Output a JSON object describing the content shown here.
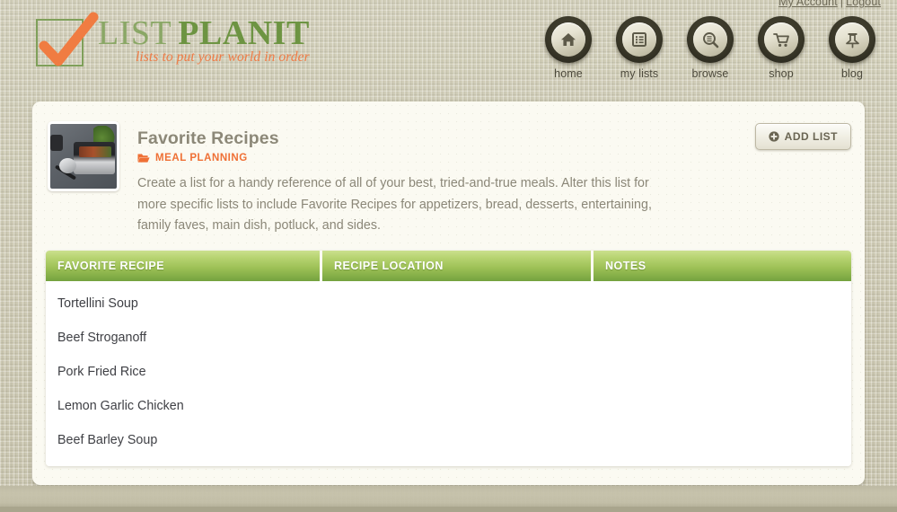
{
  "account": {
    "my_account": "My Account",
    "separator": "|",
    "logout": "Logout"
  },
  "logo": {
    "word1": "LIST",
    "word2": "PLANIT",
    "tagline": "lists to put your world in order",
    "check_icon": "orange-checkmark-icon",
    "colors": {
      "word1": "#8aa766",
      "word2": "#6d9442",
      "tagline": "#ef7b45",
      "box_border": "#7fa05a"
    }
  },
  "nav": {
    "items": [
      {
        "label": "home",
        "icon": "home-icon"
      },
      {
        "label": "my lists",
        "icon": "list-icon"
      },
      {
        "label": "browse",
        "icon": "magnifier-icon"
      },
      {
        "label": "shop",
        "icon": "shopping-cart-icon"
      },
      {
        "label": "blog",
        "icon": "pushpin-icon"
      }
    ]
  },
  "list": {
    "title": "Favorite Recipes",
    "category": "MEAL PLANNING",
    "category_icon": "open-folder-icon",
    "category_color": "#ef7035",
    "thumbnail_alt": "slow-cooker-with-food-photo",
    "description": "Create a list for a handy reference of all of your best, tried-and-true meals.  Alter this list for more specific lists to include Favorite Recipes for appetizers, bread, desserts, entertaining, family faves, main dish, potluck, and sides."
  },
  "toolbar": {
    "add_list_label": "ADD LIST",
    "add_list_icon": "plus-circle-icon"
  },
  "table": {
    "columns": [
      "FAVORITE RECIPE",
      "RECIPE LOCATION",
      "NOTES"
    ],
    "header_gradient": [
      "#cbe08e",
      "#74a23f"
    ],
    "rows": [
      {
        "recipe": "Tortellini Soup",
        "location": "",
        "notes": ""
      },
      {
        "recipe": "Beef Stroganoff",
        "location": "",
        "notes": ""
      },
      {
        "recipe": "Pork Fried Rice",
        "location": "",
        "notes": ""
      },
      {
        "recipe": "Lemon Garlic Chicken",
        "location": "",
        "notes": ""
      },
      {
        "recipe": "Beef Barley Soup",
        "location": "",
        "notes": ""
      }
    ]
  }
}
